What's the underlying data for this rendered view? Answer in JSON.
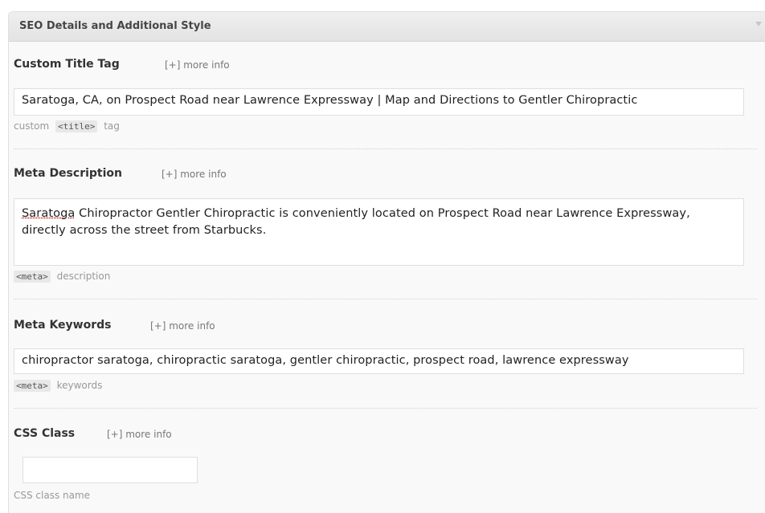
{
  "panel": {
    "title": "SEO Details and Additional Style"
  },
  "sections": {
    "title_tag": {
      "label": "Custom Title Tag",
      "more_info": "[+] more info",
      "value": "Saratoga, CA, on Prospect Road near Lawrence Expressway | Map and Directions to Gentler Chiropractic",
      "hint_prefix": "custom",
      "hint_code": "<title>",
      "hint_suffix": "tag"
    },
    "meta_description": {
      "label": "Meta Description",
      "more_info": "[+] more info",
      "value_first_word": "Saratoga",
      "value_rest": " Chiropractor Gentler Chiropractic is conveniently located on Prospect Road near Lawrence Expressway, directly across the street from Starbucks.",
      "hint_code": "<meta>",
      "hint_suffix": "description"
    },
    "meta_keywords": {
      "label": "Meta Keywords",
      "more_info": "[+] more info",
      "value": "chiropractor saratoga, chiropractic saratoga, gentler chiropractic, prospect road, lawrence expressway",
      "hint_code": "<meta>",
      "hint_suffix": "keywords"
    },
    "css_class": {
      "label": "CSS Class",
      "more_info": "[+] more info",
      "value": "",
      "hint": "CSS class name"
    }
  }
}
